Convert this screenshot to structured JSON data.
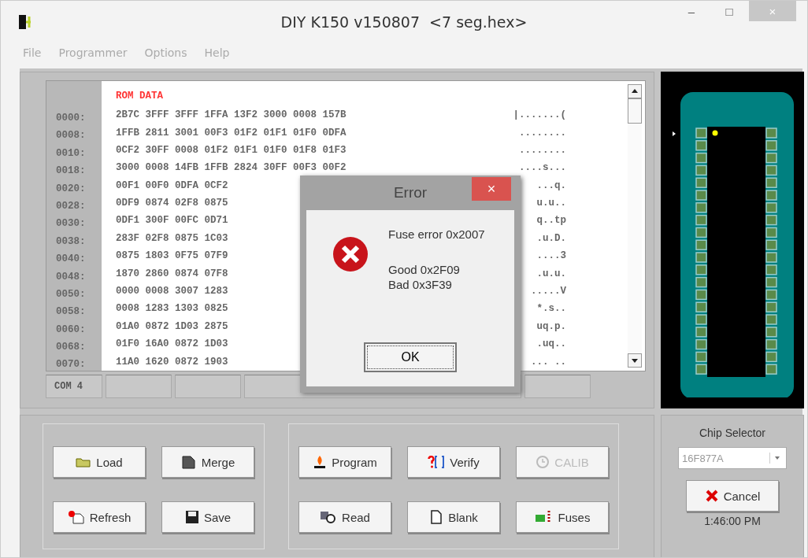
{
  "window": {
    "title": "DIY K150 v150807  <7 seg.hex>",
    "controls": [
      "–",
      "□",
      "×"
    ]
  },
  "menu": [
    {
      "label": "File"
    },
    {
      "label": "Programmer"
    },
    {
      "label": "Options"
    },
    {
      "label": "Help"
    }
  ],
  "hex_view": {
    "heading": "ROM DATA",
    "rows": [
      {
        "address": "0000:",
        "data": "2B7C 3FFF 3FFF 1FFA 13F2 3000 0008 157B",
        "ascii": "|.......("
      },
      {
        "address": "0008:",
        "data": "1FFB 2811 3001 00F3 01F2 01F1 01F0 0DFA",
        "ascii": "........"
      },
      {
        "address": "0010:",
        "data": "0CF2 30FF 0008 01F2 01F1 01F0 01F8 01F3",
        "ascii": "........"
      },
      {
        "address": "0018:",
        "data": "3000 0008 14FB 1FFB 2824 30FF 00F3 00F2",
        "ascii": "....s..."
      },
      {
        "address": "0020:",
        "data": "00F1 00F0 0DFA 0CF2",
        "ascii": "...q."
      },
      {
        "address": "0028:",
        "data": "0DF9 0874 02F8 0875",
        "ascii": "u.u.."
      },
      {
        "address": "0030:",
        "data": "0DF1 300F 00FC 0D71",
        "ascii": "q..tp"
      },
      {
        "address": "0038:",
        "data": "283F 02F8 0875 1C03",
        "ascii": ".u.D."
      },
      {
        "address": "0040:",
        "data": "0875 1803 0F75 07F9",
        "ascii": "....3"
      },
      {
        "address": "0048:",
        "data": "1870 2860 0874 07F8",
        "ascii": ".u.u."
      },
      {
        "address": "0050:",
        "data": "0000 0008 3007 1283",
        "ascii": ".....V"
      },
      {
        "address": "0058:",
        "data": "0008 1283 1303 0825",
        "ascii": "*.s.."
      },
      {
        "address": "0060:",
        "data": "01A0 0872 1D03 2875",
        "ascii": "uq.p."
      },
      {
        "address": "0068:",
        "data": "01F0 16A0 0872 1D03",
        "ascii": ".uq.."
      },
      {
        "address": "0070:",
        "data": "11A0 1620 0872 1903",
        "ascii": "... .."
      }
    ]
  },
  "status_bar": {
    "port": "COM 4"
  },
  "file_buttons": [
    {
      "label": "Load",
      "disabled": false
    },
    {
      "label": "Merge",
      "disabled": false
    },
    {
      "label": "Refresh",
      "disabled": false
    },
    {
      "label": "Save",
      "disabled": false
    }
  ],
  "device_buttons": [
    {
      "label": "Program",
      "disabled": false
    },
    {
      "label": "Verify",
      "disabled": false
    },
    {
      "label": "CALIB",
      "disabled": true
    },
    {
      "label": "Read",
      "disabled": false
    },
    {
      "label": "Blank",
      "disabled": false
    },
    {
      "label": "Fuses",
      "disabled": false
    }
  ],
  "chip_selector": {
    "label": "Chip Selector",
    "value": "16F877A",
    "cancel": "Cancel",
    "time": "1:46:00 PM"
  },
  "dialog": {
    "title": "Error",
    "close": "×",
    "lines": [
      "Fuse error 0x2007",
      "Good 0x2F09",
      "Bad 0x3F39"
    ],
    "button": "OK"
  }
}
